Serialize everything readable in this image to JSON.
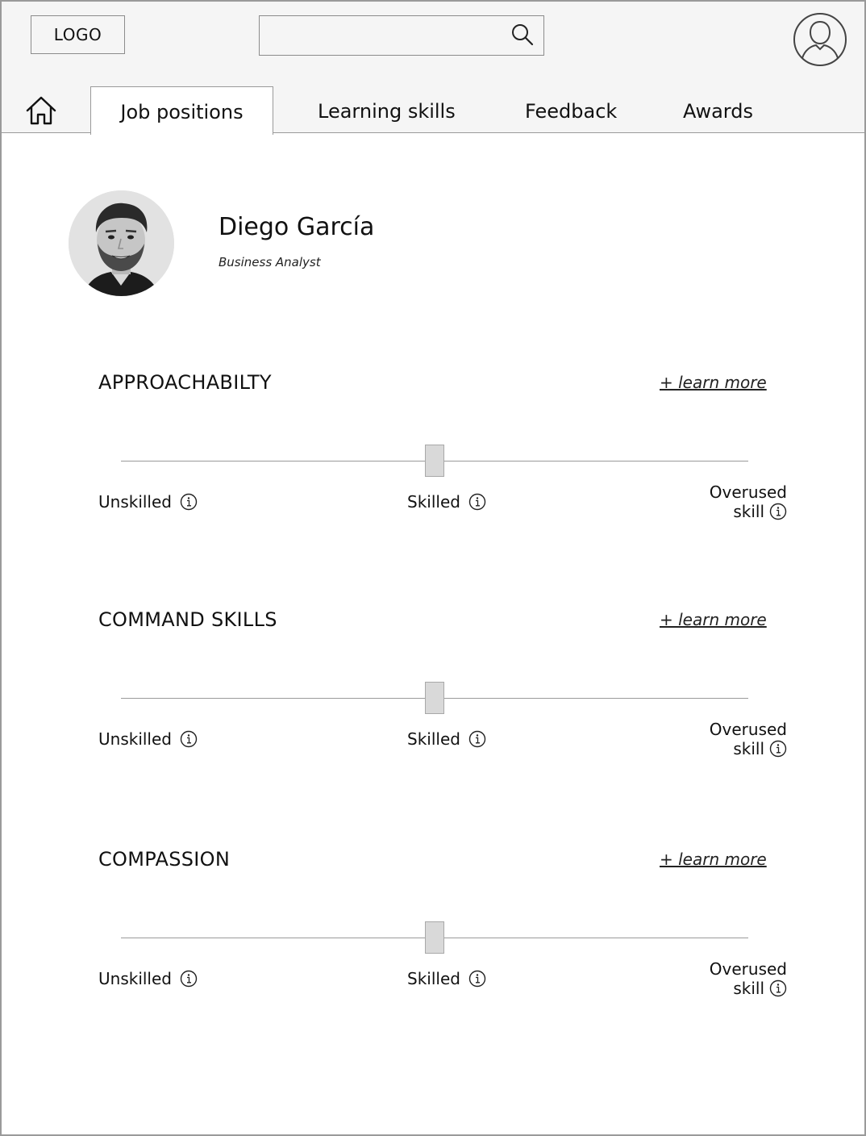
{
  "header": {
    "logo_label": "LOGO",
    "search": {
      "value": "",
      "placeholder": ""
    }
  },
  "nav": {
    "tabs": [
      {
        "label": "Job positions",
        "active": true
      },
      {
        "label": "Learning skills",
        "active": false
      },
      {
        "label": "Feedback",
        "active": false
      },
      {
        "label": "Awards",
        "active": false
      }
    ]
  },
  "profile": {
    "name": "Diego García",
    "role": "Business Analyst"
  },
  "skills": [
    {
      "title": "APPROACHABILTY",
      "learn_more": "+ learn more",
      "level": 0.5,
      "labels": {
        "unskilled": "Unskilled",
        "skilled": "Skilled",
        "overused_1": "Overused",
        "overused_2": "skill"
      }
    },
    {
      "title": "COMMAND SKILLS",
      "learn_more": "+ learn more",
      "level": 0.5,
      "labels": {
        "unskilled": "Unskilled",
        "skilled": "Skilled",
        "overused_1": "Overused",
        "overused_2": "skill"
      }
    },
    {
      "title": "COMPASSION",
      "learn_more": "+ learn more",
      "level": 0.5,
      "labels": {
        "unskilled": "Unskilled",
        "skilled": "Skilled",
        "overused_1": "Overused",
        "overused_2": "skill"
      }
    }
  ],
  "icons": {
    "home": "home-icon",
    "search": "search-icon",
    "user": "user-icon",
    "info": "info-icon"
  }
}
